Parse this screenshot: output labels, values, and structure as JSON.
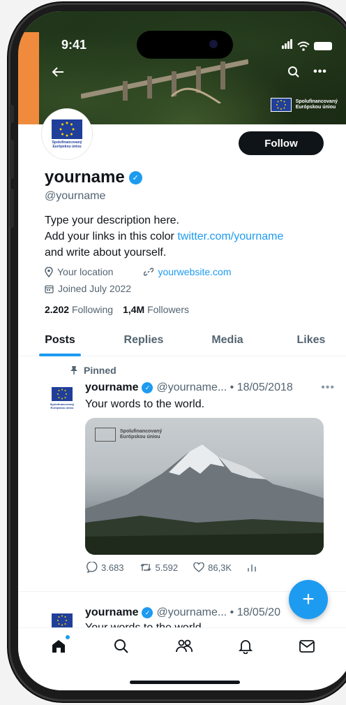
{
  "status_bar": {
    "time": "9:41"
  },
  "banner": {
    "eu_label_line1": "Spolufinancovaný",
    "eu_label_line2": "Európskou úniou"
  },
  "avatar": {
    "eu_label_line1": "Spolufinancovaný",
    "eu_label_line2": "Európskou úniou"
  },
  "profile": {
    "follow_label": "Follow",
    "display_name": "yourname",
    "handle": "@yourname",
    "bio_line1": "Type your description here.",
    "bio_line2_prefix": "Add your links in this color ",
    "bio_link": "twitter.com/yourname",
    "bio_line3": "and write about yourself.",
    "location": "Your location",
    "website": "yourwebsite.com",
    "joined": "Joined July 2022",
    "following_count": "2.202",
    "following_label": "Following",
    "followers_count": "1,4M",
    "followers_label": "Followers"
  },
  "tabs": [
    {
      "label": "Posts",
      "active": true
    },
    {
      "label": "Replies",
      "active": false
    },
    {
      "label": "Media",
      "active": false
    },
    {
      "label": "Likes",
      "active": false
    }
  ],
  "posts": [
    {
      "pinned_label": "Pinned",
      "name": "yourname",
      "handle_date": "@yourname... • 18/05/2018",
      "text": "Your words to the world.",
      "media_label_line1": "Spolufinancovaný",
      "media_label_line2": "Európskou úniou",
      "replies": "3.683",
      "reposts": "5.592",
      "likes": "86,3K"
    },
    {
      "name": "yourname",
      "handle_date": "@yourname... • 18/05/20",
      "text": "Your words to the world."
    }
  ],
  "colors": {
    "accent": "#1d9bf0",
    "text": "#0f1419",
    "muted": "#536471",
    "eu_blue": "#1f3f9a",
    "banner_orange": "#f08a3c"
  }
}
